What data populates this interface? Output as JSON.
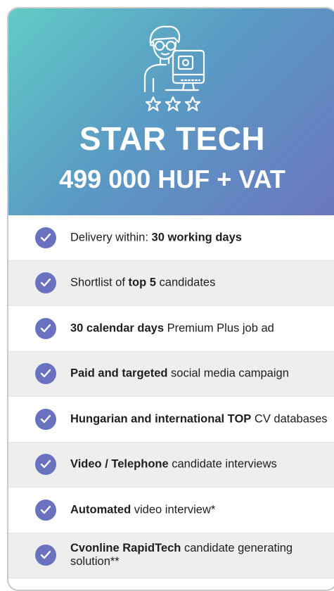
{
  "card": {
    "title": "STAR TECH",
    "price": "499 000 HUF + VAT",
    "icon": "developer-with-monitor-and-stars-icon",
    "colors": {
      "gradient_start": "#62cbc6",
      "gradient_end": "#6b76bf",
      "check": "#6872bf"
    }
  },
  "features": [
    {
      "pre": "Delivery within: ",
      "bold": "30 working days",
      "post": ""
    },
    {
      "pre": "Shortlist of ",
      "bold": "top 5",
      "post": " candidates"
    },
    {
      "pre": "",
      "bold": "30 calendar days",
      "post": " Premium Plus job ad"
    },
    {
      "pre": "",
      "bold": "Paid and targeted",
      "post": " social media campaign"
    },
    {
      "pre": "",
      "bold": "Hungarian and international TOP",
      "post": " CV databases"
    },
    {
      "pre": "",
      "bold": "Video / Telephone",
      "post": " candidate interviews"
    },
    {
      "pre": "",
      "bold": "Automated",
      "post": " video interview*"
    },
    {
      "pre": "",
      "bold": "Cvonline RapidTech",
      "post": " candidate generating solution**"
    }
  ]
}
